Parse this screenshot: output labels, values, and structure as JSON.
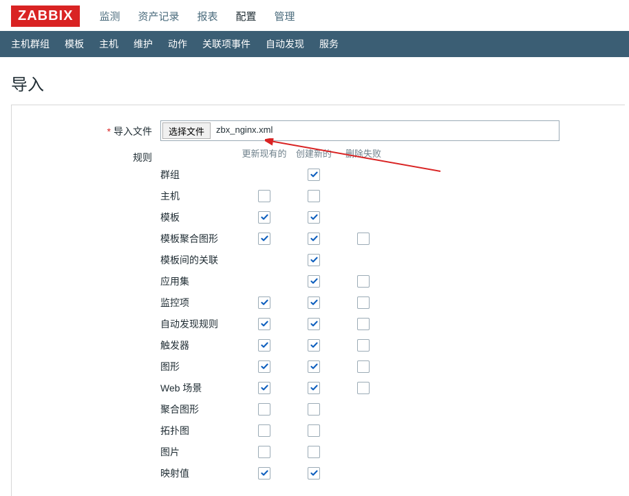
{
  "logo": "ZABBIX",
  "topmenu": {
    "items": [
      {
        "label": "监测"
      },
      {
        "label": "资产记录"
      },
      {
        "label": "报表"
      },
      {
        "label": "配置"
      },
      {
        "label": "管理"
      }
    ],
    "active_index": 3
  },
  "subnav": {
    "items": [
      {
        "label": "主机群组"
      },
      {
        "label": "模板"
      },
      {
        "label": "主机"
      },
      {
        "label": "维护"
      },
      {
        "label": "动作"
      },
      {
        "label": "关联项事件"
      },
      {
        "label": "自动发现"
      },
      {
        "label": "服务"
      }
    ]
  },
  "page_title": "导入",
  "form": {
    "import_file_label": "导入文件",
    "file_button_label": "选择文件",
    "file_name": "zbx_nginx.xml",
    "rules_label": "规则",
    "columns": {
      "update": "更新现有的",
      "create": "创建新的",
      "delete": "删除失败"
    },
    "rules": [
      {
        "name": "群组",
        "update": null,
        "create": true,
        "delete": null
      },
      {
        "name": "主机",
        "update": false,
        "create": false,
        "delete": null
      },
      {
        "name": "模板",
        "update": true,
        "create": true,
        "delete": null
      },
      {
        "name": "模板聚合图形",
        "update": true,
        "create": true,
        "delete": false
      },
      {
        "name": "模板间的关联",
        "update": null,
        "create": true,
        "delete": null
      },
      {
        "name": "应用集",
        "update": null,
        "create": true,
        "delete": false
      },
      {
        "name": "监控项",
        "update": true,
        "create": true,
        "delete": false
      },
      {
        "name": "自动发现规则",
        "update": true,
        "create": true,
        "delete": false
      },
      {
        "name": "触发器",
        "update": true,
        "create": true,
        "delete": false
      },
      {
        "name": "图形",
        "update": true,
        "create": true,
        "delete": false
      },
      {
        "name": "Web 场景",
        "update": true,
        "create": true,
        "delete": false
      },
      {
        "name": "聚合图形",
        "update": false,
        "create": false,
        "delete": null
      },
      {
        "name": "拓扑图",
        "update": false,
        "create": false,
        "delete": null
      },
      {
        "name": "图片",
        "update": false,
        "create": false,
        "delete": null
      },
      {
        "name": "映射值",
        "update": true,
        "create": true,
        "delete": null
      }
    ]
  }
}
